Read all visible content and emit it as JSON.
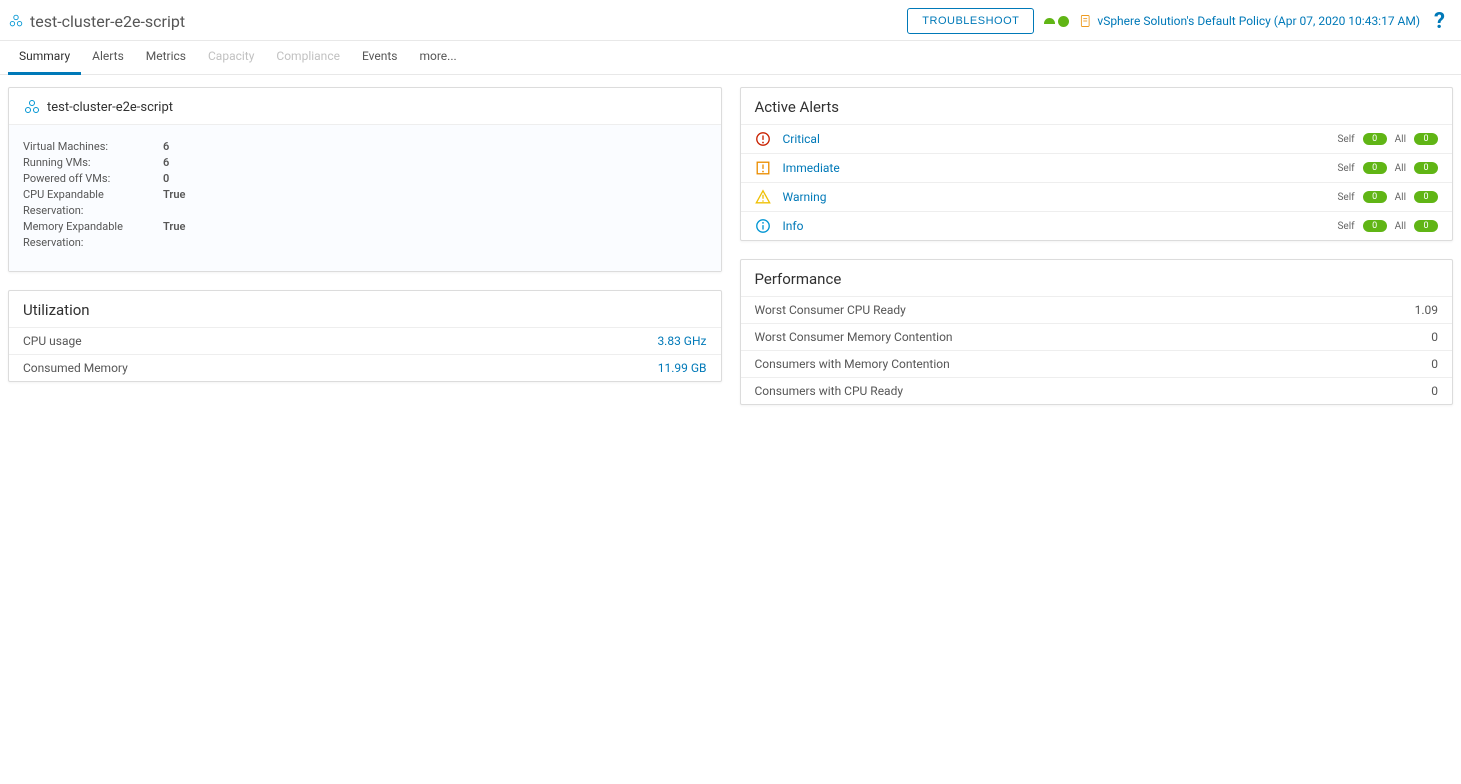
{
  "header": {
    "title": "test-cluster-e2e-script",
    "troubleshoot_label": "TROUBLESHOOT",
    "policy_text": "vSphere Solution's Default Policy (Apr 07, 2020 10:43:17 AM)",
    "help_glyph": "?"
  },
  "tabs": [
    {
      "label": "Summary",
      "active": true,
      "disabled": false
    },
    {
      "label": "Alerts",
      "active": false,
      "disabled": false
    },
    {
      "label": "Metrics",
      "active": false,
      "disabled": false
    },
    {
      "label": "Capacity",
      "active": false,
      "disabled": true
    },
    {
      "label": "Compliance",
      "active": false,
      "disabled": true
    },
    {
      "label": "Events",
      "active": false,
      "disabled": false
    },
    {
      "label": "more...",
      "active": false,
      "disabled": false
    }
  ],
  "info_card": {
    "title": "test-cluster-e2e-script",
    "rows": [
      {
        "label": "Virtual Machines:",
        "value": "6"
      },
      {
        "label": "Running VMs:",
        "value": "6"
      },
      {
        "label": "Powered off VMs:",
        "value": "0"
      },
      {
        "label": "CPU Expandable Reservation:",
        "value": "True"
      },
      {
        "label": "Memory Expandable Reservation:",
        "value": "True"
      }
    ]
  },
  "alerts_card": {
    "title": "Active Alerts",
    "self_label": "Self",
    "all_label": "All",
    "rows": [
      {
        "label": "Critical",
        "self": "0",
        "all": "0",
        "color": "#c92100",
        "kind": "critical"
      },
      {
        "label": "Immediate",
        "self": "0",
        "all": "0",
        "color": "#eb8d00",
        "kind": "immediate"
      },
      {
        "label": "Warning",
        "self": "0",
        "all": "0",
        "color": "#efc006",
        "kind": "warning"
      },
      {
        "label": "Info",
        "self": "0",
        "all": "0",
        "color": "#0095d3",
        "kind": "info"
      }
    ]
  },
  "utilization_card": {
    "title": "Utilization",
    "rows": [
      {
        "label": "CPU usage",
        "value": "3.83 GHz"
      },
      {
        "label": "Consumed Memory",
        "value": "11.99 GB"
      }
    ]
  },
  "performance_card": {
    "title": "Performance",
    "rows": [
      {
        "label": "Worst Consumer CPU Ready",
        "value": "1.09"
      },
      {
        "label": "Worst Consumer Memory Contention",
        "value": "0"
      },
      {
        "label": "Consumers with Memory Contention",
        "value": "0"
      },
      {
        "label": "Consumers with CPU Ready",
        "value": "0"
      }
    ]
  }
}
